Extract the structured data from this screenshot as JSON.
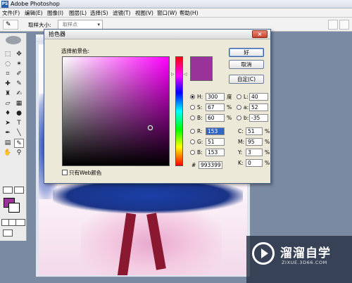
{
  "app": {
    "title": "Adobe Photoshop",
    "icon": "PS"
  },
  "menu": [
    {
      "label": "文件(F)"
    },
    {
      "label": "编辑(E)"
    },
    {
      "label": "图像(I)"
    },
    {
      "label": "图层(L)"
    },
    {
      "label": "选择(S)"
    },
    {
      "label": "滤镜(T)"
    },
    {
      "label": "视图(V)"
    },
    {
      "label": "窗口(W)"
    },
    {
      "label": "帮助(H)"
    }
  ],
  "options": {
    "sample_label": "取样大小:",
    "sample_value": "取样点"
  },
  "document": {
    "tab_title": "20"
  },
  "dialog": {
    "title": "拾色器",
    "close": "×",
    "pick_label": "选择前景色:",
    "ok": "好",
    "cancel": "取消",
    "custom": "自定(C)",
    "web_only": "只有Web颜色",
    "new_color": "#993399",
    "hue_marker_l": "▷",
    "hue_marker_r": "◁",
    "hsb": {
      "h_label": "H:",
      "h_value": "300",
      "h_unit": "度",
      "s_label": "S:",
      "s_value": "67",
      "s_unit": "%",
      "b_label": "B:",
      "b_value": "60",
      "b_unit": "%"
    },
    "rgb": {
      "r_label": "R:",
      "r_value": "153",
      "g_label": "G:",
      "g_value": "51",
      "b_label": "B:",
      "b_value": "153"
    },
    "lab": {
      "l_label": "L:",
      "l_value": "40",
      "a_label": "a:",
      "a_value": "52",
      "b_label": "b:",
      "b_value": "-35"
    },
    "cmyk": {
      "c_label": "C:",
      "c_value": "51",
      "c_unit": "%",
      "m_label": "M:",
      "m_value": "95",
      "m_unit": "%",
      "y_label": "Y:",
      "y_value": "3",
      "y_unit": "%",
      "k_label": "K:",
      "k_value": "0",
      "k_unit": "%"
    },
    "hex_label": "#",
    "hex_value": "993399"
  },
  "toolbox": {
    "foreground": "#993399",
    "background": "#ffffff"
  },
  "watermark": {
    "title": "溜溜自学",
    "subtitle": "ZIXUE.3D66.COM"
  }
}
